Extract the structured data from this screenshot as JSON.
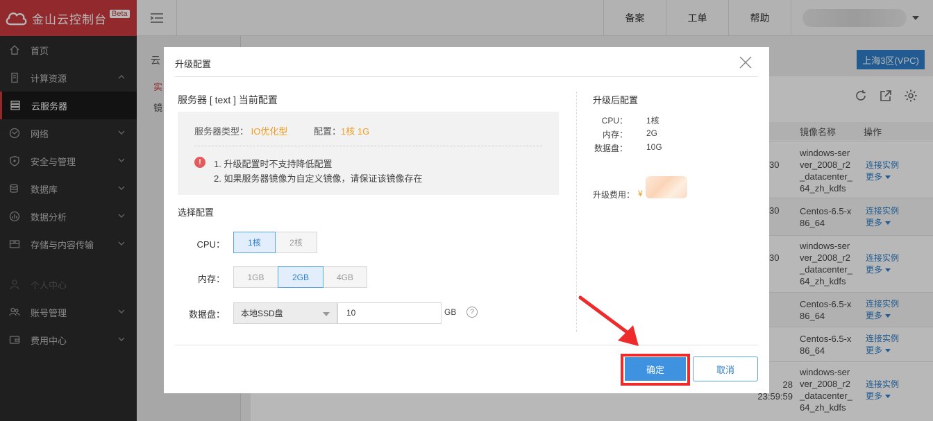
{
  "brand": {
    "name": "金山云控制台",
    "badge": "Beta",
    "accent": "#c9393f"
  },
  "sidebar": {
    "items": [
      {
        "label": "首页",
        "icon": "home-icon"
      },
      {
        "label": "计算资源",
        "icon": "server-icon",
        "expanded": true
      },
      {
        "label": "云服务器",
        "icon": "list-icon",
        "active": true
      },
      {
        "label": "网络",
        "icon": "network-icon"
      },
      {
        "label": "安全与管理",
        "icon": "shield-icon"
      },
      {
        "label": "数据库",
        "icon": "database-icon"
      },
      {
        "label": "数据分析",
        "icon": "analytics-icon"
      },
      {
        "label": "存储与内容传输",
        "icon": "storage-icon"
      },
      {
        "label": "个人中心",
        "icon": "person-icon",
        "muted": true
      },
      {
        "label": "账号管理",
        "icon": "users-icon"
      },
      {
        "label": "费用中心",
        "icon": "wallet-icon"
      }
    ]
  },
  "topbar": {
    "links": [
      "备案",
      "工单",
      "帮助"
    ]
  },
  "background": {
    "subnav_title": "云",
    "subnav_item1": "实",
    "subnav_item2": "镜",
    "region_button": "上海3区(VPC)",
    "table_headers": {
      "image": "镜像名称",
      "ops": "操作"
    },
    "rows": [
      {
        "time": "30",
        "image": "windows-server_2008_r2_datacenter_64_zh_kdfs",
        "op": "连接实例",
        "more": "更多"
      },
      {
        "time": "30",
        "image": "Centos-6.5-x86_64",
        "op": "连接实例",
        "more": "更多"
      },
      {
        "time": "30",
        "image": "windows-server_2008_r2_datacenter_64_zh_kdfs",
        "op": "连接实例",
        "more": "更多"
      },
      {
        "time": "",
        "image": "Centos-6.5-x86_64",
        "op": "连接实例",
        "more": "更多"
      },
      {
        "time": "",
        "image": "Centos-6.5-x86_64",
        "op": "连接实例",
        "more": "更多"
      },
      {
        "time": "28",
        "time2": "23:59:59",
        "image": "windows-server_2008_r2_datacenter_64_zh_kdfs",
        "op": "连接实例",
        "more": "更多"
      }
    ]
  },
  "modal": {
    "title": "升级配置",
    "current_title": "服务器 [ text ] 当前配置",
    "current": {
      "type_label": "服务器类型：",
      "type_value": "IO优化型",
      "config_label": "配置：",
      "config_value": "1核 1G"
    },
    "warnings": [
      "1. 升级配置时不支持降低配置",
      "2. 如果服务器镜像为自定义镜像，请保证该镜像存在"
    ],
    "select_title": "选择配置",
    "cpu_label": "CPU：",
    "cpu_options": [
      "1核",
      "2核"
    ],
    "cpu_selected": "1核",
    "memory_label": "内存：",
    "memory_options": [
      "1GB",
      "2GB",
      "4GB"
    ],
    "memory_selected": "2GB",
    "disk_label": "数据盘：",
    "disk_type": "本地SSD盘",
    "disk_size": "10",
    "disk_unit": "GB",
    "after_title": "升级后配置",
    "after": [
      {
        "label": "CPU：",
        "value": "1核"
      },
      {
        "label": "内存：",
        "value": "2G"
      },
      {
        "label": "数据盘：",
        "value": "10G"
      }
    ],
    "fee_label": "升级费用：",
    "fee_currency": "¥",
    "confirm": "确定",
    "cancel": "取消",
    "highlight_color": "#ee2a2a",
    "primary_color": "#3e92e0"
  }
}
